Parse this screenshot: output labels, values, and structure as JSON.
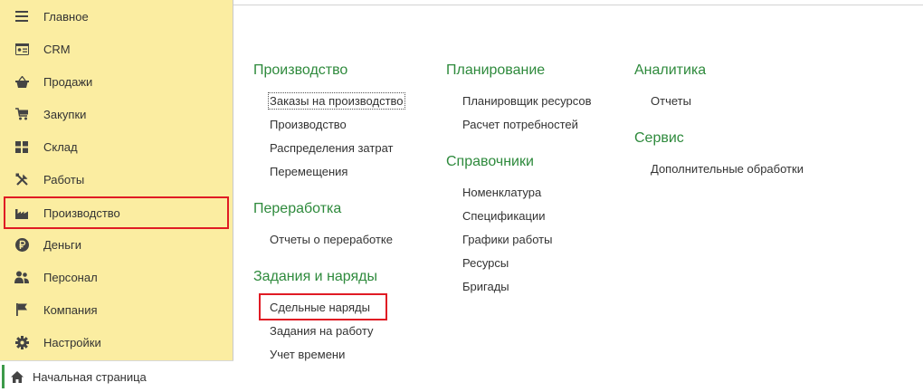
{
  "sidebar": {
    "items": [
      {
        "label": "Главное",
        "icon": "menu-lines-icon"
      },
      {
        "label": "CRM",
        "icon": "contact-card-icon"
      },
      {
        "label": "Продажи",
        "icon": "shopping-basket-icon"
      },
      {
        "label": "Закупки",
        "icon": "shopping-cart-icon"
      },
      {
        "label": "Склад",
        "icon": "warehouse-grid-icon"
      },
      {
        "label": "Работы",
        "icon": "tools-icon"
      },
      {
        "label": "Производство",
        "icon": "factory-icon"
      },
      {
        "label": "Деньги",
        "icon": "ruble-coin-icon"
      },
      {
        "label": "Персонал",
        "icon": "people-icon"
      },
      {
        "label": "Компания",
        "icon": "flag-icon"
      },
      {
        "label": "Настройки",
        "icon": "gear-icon"
      }
    ],
    "home": {
      "label": "Начальная страница",
      "icon": "home-icon"
    }
  },
  "content": {
    "groups": [
      {
        "title": "Производство",
        "links": [
          "Заказы на производство",
          "Производство",
          "Распределения затрат",
          "Перемещения"
        ]
      },
      {
        "title": "Переработка",
        "links": [
          "Отчеты о переработке"
        ]
      },
      {
        "title": "Задания и наряды",
        "links": [
          "Сдельные наряды",
          "Задания на работу",
          "Учет времени"
        ]
      },
      {
        "title": "Планирование",
        "links": [
          "Планировщик ресурсов",
          "Расчет потребностей"
        ]
      },
      {
        "title": "Справочники",
        "links": [
          "Номенклатура",
          "Спецификации",
          "Графики работы",
          "Ресурсы",
          "Бригады"
        ]
      },
      {
        "title": "Аналитика",
        "links": [
          "Отчеты"
        ]
      },
      {
        "title": "Сервис",
        "links": [
          "Дополнительные обработки"
        ]
      }
    ]
  },
  "colors": {
    "sidebar_bg": "#fbeda1",
    "group_title": "#2e8a3c",
    "highlight": "#e01b24",
    "active_bar": "#3c9a4a"
  }
}
